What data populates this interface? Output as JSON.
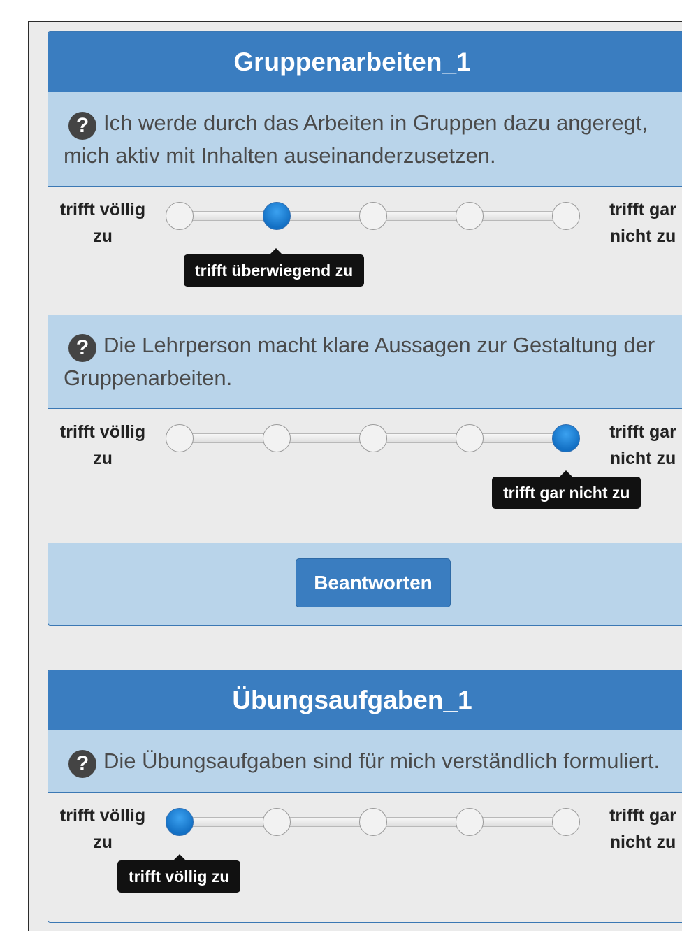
{
  "panels": [
    {
      "title": "Gruppenarbeiten_1",
      "questions": [
        {
          "text": "Ich werde durch das Arbeiten in Gruppen dazu angeregt, mich aktiv mit Inhalten auseinanderzusetzen.",
          "scale_left": "trifft völlig zu",
          "scale_right": "trifft gar nicht zu",
          "selected_index": 1,
          "selected_label": "trifft überwiegend zu"
        },
        {
          "text": "Die Lehrperson macht klare Aussagen zur Gestaltung der Gruppenarbeiten.",
          "scale_left": "trifft völlig zu",
          "scale_right": "trifft gar nicht zu",
          "selected_index": 4,
          "selected_label": "trifft gar nicht zu"
        }
      ],
      "submit_label": "Beantworten"
    },
    {
      "title": "Übungsaufgaben_1",
      "questions": [
        {
          "text": "Die Übungsaufgaben sind für mich verständlich formuliert.",
          "scale_left": "trifft völlig zu",
          "scale_right": "trifft gar nicht zu",
          "selected_index": 0,
          "selected_label": "trifft völlig zu"
        }
      ]
    }
  ],
  "help_icon_glyph": "?",
  "icons": [
    "question-circle-icon"
  ],
  "colors": {
    "heading_bg": "#3a7dc0",
    "question_bg": "#b9d4ea",
    "rating_bg": "#ebebeb",
    "selected_dot": "#1a7fd6",
    "tooltip_bg": "#111111"
  }
}
